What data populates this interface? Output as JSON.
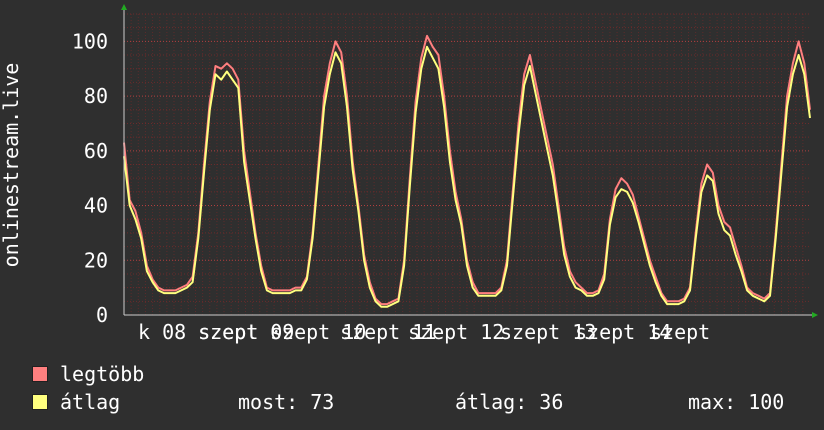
{
  "chart_data": {
    "type": "line",
    "ylabel": "onlinestream.live",
    "ylim": [
      0,
      110
    ],
    "yticks": [
      0,
      20,
      40,
      60,
      80,
      100
    ],
    "grid": true,
    "x_tick_labels": [
      "k 08 szept",
      "szept 09",
      "szept 10",
      "szept 11",
      "szept 12",
      "szept 13",
      "szept 14",
      "szept"
    ],
    "colors": {
      "legtobb": "#ff7f7f",
      "atlag": "#ffff7f",
      "axis": "#cccccc",
      "grid": "#7a2a2a",
      "background": "#2f2f2f"
    },
    "series": [
      {
        "name": "legtöbb",
        "values": [
          63,
          42,
          38,
          30,
          18,
          13,
          10,
          9,
          9,
          9,
          10,
          11,
          14,
          30,
          55,
          78,
          91,
          90,
          92,
          90,
          86,
          60,
          45,
          30,
          18,
          10,
          9,
          9,
          9,
          9,
          10,
          10,
          14,
          30,
          55,
          80,
          92,
          100,
          96,
          80,
          56,
          40,
          22,
          12,
          6,
          4,
          4,
          5,
          6,
          20,
          50,
          78,
          94,
          102,
          98,
          95,
          80,
          60,
          45,
          35,
          20,
          12,
          8,
          8,
          8,
          8,
          10,
          20,
          45,
          70,
          88,
          95,
          85,
          75,
          65,
          55,
          40,
          25,
          16,
          12,
          10,
          8,
          8,
          9,
          15,
          35,
          46,
          50,
          48,
          44,
          36,
          28,
          20,
          14,
          8,
          5,
          5,
          5,
          6,
          10,
          30,
          48,
          55,
          52,
          40,
          34,
          32,
          25,
          18,
          10,
          8,
          7,
          6,
          8,
          30,
          55,
          80,
          92,
          100,
          92,
          75
        ]
      },
      {
        "name": "átlag",
        "values": [
          58,
          40,
          35,
          28,
          16,
          12,
          9,
          8,
          8,
          8,
          9,
          10,
          12,
          28,
          52,
          75,
          88,
          86,
          89,
          86,
          83,
          56,
          42,
          28,
          16,
          9,
          8,
          8,
          8,
          8,
          9,
          9,
          13,
          28,
          52,
          76,
          88,
          96,
          92,
          76,
          53,
          38,
          20,
          10,
          5,
          3,
          3,
          4,
          5,
          18,
          47,
          74,
          90,
          98,
          94,
          90,
          76,
          56,
          42,
          33,
          18,
          10,
          7,
          7,
          7,
          7,
          9,
          18,
          42,
          66,
          84,
          91,
          81,
          71,
          61,
          51,
          37,
          22,
          14,
          10,
          9,
          7,
          7,
          8,
          13,
          33,
          43,
          46,
          45,
          41,
          34,
          26,
          18,
          12,
          7,
          4,
          4,
          4,
          5,
          9,
          28,
          45,
          51,
          49,
          37,
          31,
          29,
          22,
          16,
          9,
          7,
          6,
          5,
          7,
          28,
          52,
          76,
          88,
          95,
          88,
          72
        ]
      }
    ]
  },
  "legend": [
    {
      "label": "legtöbb",
      "color": "#ff7f7f"
    },
    {
      "label": "átlag",
      "color": "#ffff7f"
    }
  ],
  "stats": {
    "most": "most: 73",
    "atlag": "átlag: 36",
    "max": "max: 100"
  }
}
